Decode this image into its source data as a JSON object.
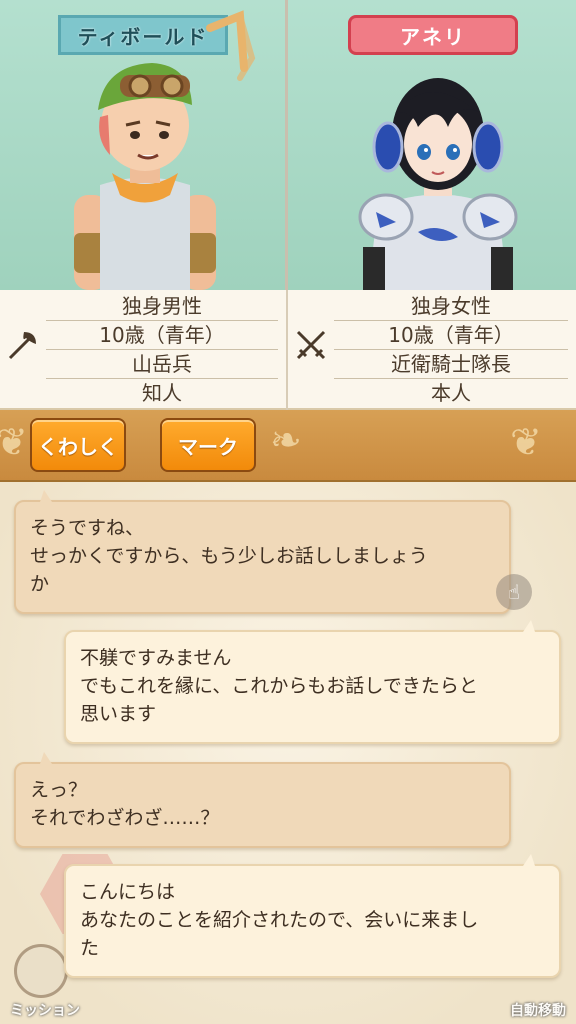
{
  "characters": {
    "left": {
      "name": "ティボールド",
      "info": [
        "独身男性",
        "10歳（青年）",
        "山岳兵",
        "知人"
      ],
      "job_icon": "axe-icon"
    },
    "right": {
      "name": "アネリ",
      "info": [
        "独身女性",
        "10歳（青年）",
        "近衛騎士隊長",
        "本人"
      ],
      "job_icon": "crossed-swords-icon"
    }
  },
  "buttons": {
    "details": "くわしく",
    "mark": "マーク"
  },
  "chat": [
    {
      "side": "other",
      "lines": [
        "そうですね、",
        "せっかくですから、もう少しお話ししましょう",
        "か"
      ]
    },
    {
      "side": "self",
      "lines": [
        "不躾ですみません",
        "でもこれを縁に、これからもお話しできたらと",
        "思います"
      ]
    },
    {
      "side": "other",
      "lines": [
        "えっ？",
        "それでわざわざ……？"
      ]
    },
    {
      "side": "self",
      "lines": [
        "こんにちは",
        "あなたのことを紹介されたので、会いに来まし",
        "た"
      ]
    }
  ],
  "hud": {
    "mission": "ミッション",
    "auto_move": "自動移動"
  },
  "colors": {
    "male_tag": "#7fc6cc",
    "female_tag": "#f07c86",
    "button_orange": "#f5960f"
  }
}
